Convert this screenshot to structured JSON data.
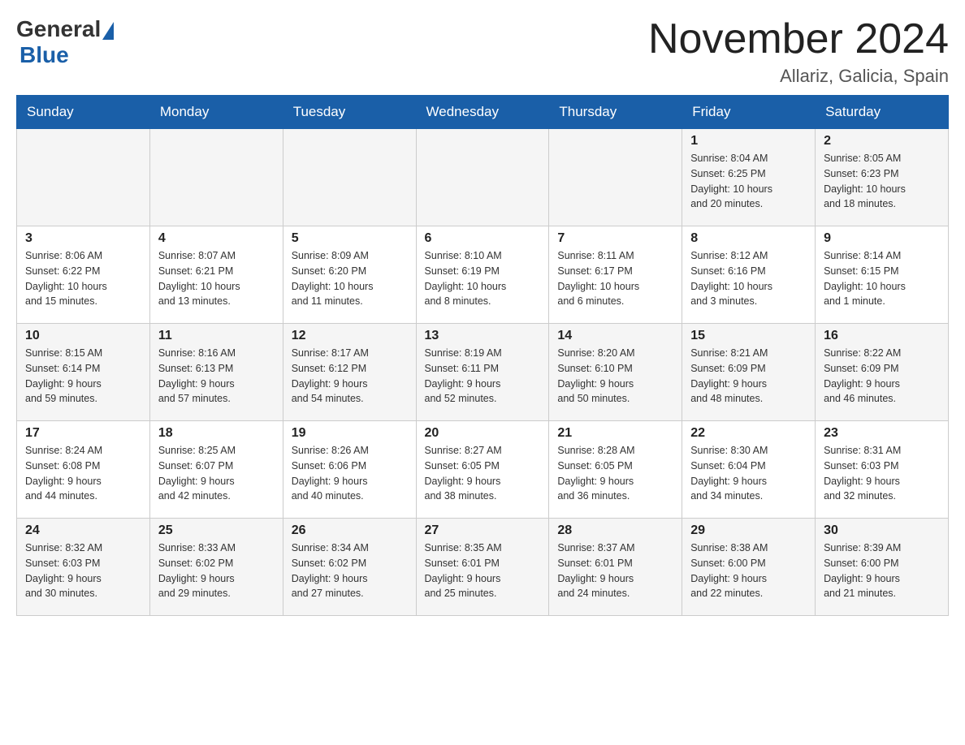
{
  "header": {
    "logo_general": "General",
    "logo_blue": "Blue",
    "title": "November 2024",
    "subtitle": "Allariz, Galicia, Spain"
  },
  "days_of_week": [
    "Sunday",
    "Monday",
    "Tuesday",
    "Wednesday",
    "Thursday",
    "Friday",
    "Saturday"
  ],
  "weeks": [
    {
      "days": [
        {
          "number": "",
          "info": ""
        },
        {
          "number": "",
          "info": ""
        },
        {
          "number": "",
          "info": ""
        },
        {
          "number": "",
          "info": ""
        },
        {
          "number": "",
          "info": ""
        },
        {
          "number": "1",
          "info": "Sunrise: 8:04 AM\nSunset: 6:25 PM\nDaylight: 10 hours\nand 20 minutes."
        },
        {
          "number": "2",
          "info": "Sunrise: 8:05 AM\nSunset: 6:23 PM\nDaylight: 10 hours\nand 18 minutes."
        }
      ]
    },
    {
      "days": [
        {
          "number": "3",
          "info": "Sunrise: 8:06 AM\nSunset: 6:22 PM\nDaylight: 10 hours\nand 15 minutes."
        },
        {
          "number": "4",
          "info": "Sunrise: 8:07 AM\nSunset: 6:21 PM\nDaylight: 10 hours\nand 13 minutes."
        },
        {
          "number": "5",
          "info": "Sunrise: 8:09 AM\nSunset: 6:20 PM\nDaylight: 10 hours\nand 11 minutes."
        },
        {
          "number": "6",
          "info": "Sunrise: 8:10 AM\nSunset: 6:19 PM\nDaylight: 10 hours\nand 8 minutes."
        },
        {
          "number": "7",
          "info": "Sunrise: 8:11 AM\nSunset: 6:17 PM\nDaylight: 10 hours\nand 6 minutes."
        },
        {
          "number": "8",
          "info": "Sunrise: 8:12 AM\nSunset: 6:16 PM\nDaylight: 10 hours\nand 3 minutes."
        },
        {
          "number": "9",
          "info": "Sunrise: 8:14 AM\nSunset: 6:15 PM\nDaylight: 10 hours\nand 1 minute."
        }
      ]
    },
    {
      "days": [
        {
          "number": "10",
          "info": "Sunrise: 8:15 AM\nSunset: 6:14 PM\nDaylight: 9 hours\nand 59 minutes."
        },
        {
          "number": "11",
          "info": "Sunrise: 8:16 AM\nSunset: 6:13 PM\nDaylight: 9 hours\nand 57 minutes."
        },
        {
          "number": "12",
          "info": "Sunrise: 8:17 AM\nSunset: 6:12 PM\nDaylight: 9 hours\nand 54 minutes."
        },
        {
          "number": "13",
          "info": "Sunrise: 8:19 AM\nSunset: 6:11 PM\nDaylight: 9 hours\nand 52 minutes."
        },
        {
          "number": "14",
          "info": "Sunrise: 8:20 AM\nSunset: 6:10 PM\nDaylight: 9 hours\nand 50 minutes."
        },
        {
          "number": "15",
          "info": "Sunrise: 8:21 AM\nSunset: 6:09 PM\nDaylight: 9 hours\nand 48 minutes."
        },
        {
          "number": "16",
          "info": "Sunrise: 8:22 AM\nSunset: 6:09 PM\nDaylight: 9 hours\nand 46 minutes."
        }
      ]
    },
    {
      "days": [
        {
          "number": "17",
          "info": "Sunrise: 8:24 AM\nSunset: 6:08 PM\nDaylight: 9 hours\nand 44 minutes."
        },
        {
          "number": "18",
          "info": "Sunrise: 8:25 AM\nSunset: 6:07 PM\nDaylight: 9 hours\nand 42 minutes."
        },
        {
          "number": "19",
          "info": "Sunrise: 8:26 AM\nSunset: 6:06 PM\nDaylight: 9 hours\nand 40 minutes."
        },
        {
          "number": "20",
          "info": "Sunrise: 8:27 AM\nSunset: 6:05 PM\nDaylight: 9 hours\nand 38 minutes."
        },
        {
          "number": "21",
          "info": "Sunrise: 8:28 AM\nSunset: 6:05 PM\nDaylight: 9 hours\nand 36 minutes."
        },
        {
          "number": "22",
          "info": "Sunrise: 8:30 AM\nSunset: 6:04 PM\nDaylight: 9 hours\nand 34 minutes."
        },
        {
          "number": "23",
          "info": "Sunrise: 8:31 AM\nSunset: 6:03 PM\nDaylight: 9 hours\nand 32 minutes."
        }
      ]
    },
    {
      "days": [
        {
          "number": "24",
          "info": "Sunrise: 8:32 AM\nSunset: 6:03 PM\nDaylight: 9 hours\nand 30 minutes."
        },
        {
          "number": "25",
          "info": "Sunrise: 8:33 AM\nSunset: 6:02 PM\nDaylight: 9 hours\nand 29 minutes."
        },
        {
          "number": "26",
          "info": "Sunrise: 8:34 AM\nSunset: 6:02 PM\nDaylight: 9 hours\nand 27 minutes."
        },
        {
          "number": "27",
          "info": "Sunrise: 8:35 AM\nSunset: 6:01 PM\nDaylight: 9 hours\nand 25 minutes."
        },
        {
          "number": "28",
          "info": "Sunrise: 8:37 AM\nSunset: 6:01 PM\nDaylight: 9 hours\nand 24 minutes."
        },
        {
          "number": "29",
          "info": "Sunrise: 8:38 AM\nSunset: 6:00 PM\nDaylight: 9 hours\nand 22 minutes."
        },
        {
          "number": "30",
          "info": "Sunrise: 8:39 AM\nSunset: 6:00 PM\nDaylight: 9 hours\nand 21 minutes."
        }
      ]
    }
  ]
}
